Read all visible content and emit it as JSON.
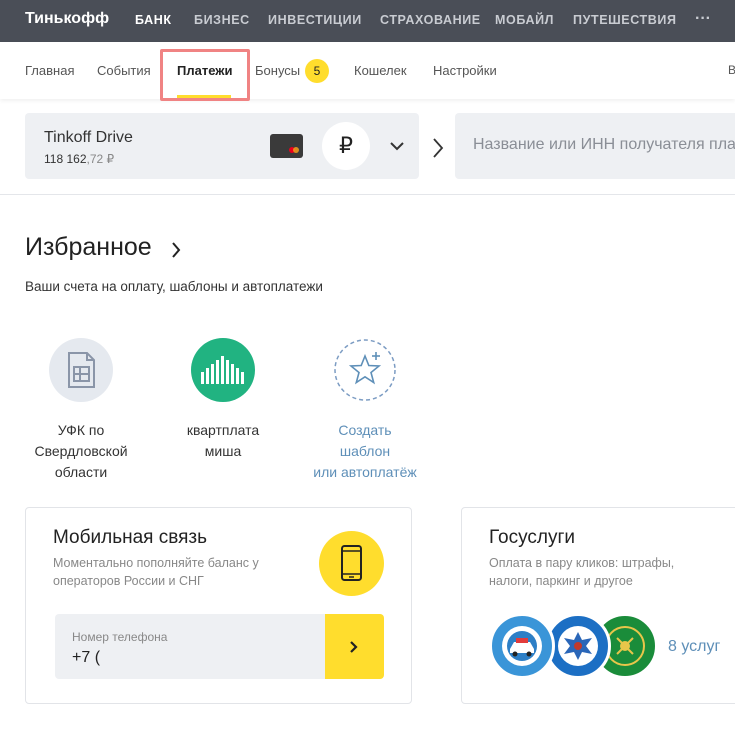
{
  "topnav": {
    "logo": "Тинькофф",
    "items": [
      {
        "label": "БАНК",
        "active": true
      },
      {
        "label": "БИЗНЕС"
      },
      {
        "label": "ИНВЕСТИЦИИ"
      },
      {
        "label": "СТРАХОВАНИЕ"
      },
      {
        "label": "МОБАЙЛ"
      },
      {
        "label": "ПУТЕШЕСТВИЯ"
      }
    ],
    "more": "···"
  },
  "subnav": {
    "items": [
      {
        "label": "Главная"
      },
      {
        "label": "События"
      },
      {
        "label": "Платежи",
        "active": true
      },
      {
        "label": "Бонусы"
      },
      {
        "label": "Кошелек"
      },
      {
        "label": "Настройки"
      }
    ],
    "bonus_count": "5",
    "edge_text": "В"
  },
  "account": {
    "name": "Tinkoff Drive",
    "balance_int": "118 162",
    "balance_dec": ",72 ₽",
    "currency_symbol": "₽"
  },
  "search": {
    "placeholder": "Название или ИНН получателя платежа"
  },
  "favorites": {
    "title": "Избранное",
    "subtitle": "Ваши счета на оплату, шаблоны и автоплатежи",
    "items": [
      {
        "line1": "УФК по",
        "line2": "Свердловской",
        "line3": "области",
        "icon": "document-icon"
      },
      {
        "line1": "квартплата",
        "line2": "миша",
        "icon": "building-bars-icon"
      },
      {
        "line1": "Создать",
        "line2": "шаблон",
        "line3": "или автоплатёж",
        "icon": "add-star-icon"
      }
    ]
  },
  "mobile": {
    "title": "Мобильная связь",
    "desc_line1": "Моментально пополняйте баланс у",
    "desc_line2": "операторов России и СНГ",
    "field_label": "Номер телефона",
    "field_value": "+7 ("
  },
  "gosuslugi": {
    "title": "Госуслуги",
    "desc_line1": "Оплата в пару кликов: штрафы,",
    "desc_line2": "налоги, паркинг и другое",
    "services_link": "8 услуг"
  },
  "colors": {
    "accent_yellow": "#ffdd2d",
    "topbar": "#4a4e57",
    "link_blue": "#5e8fb8",
    "green": "#21b381"
  }
}
